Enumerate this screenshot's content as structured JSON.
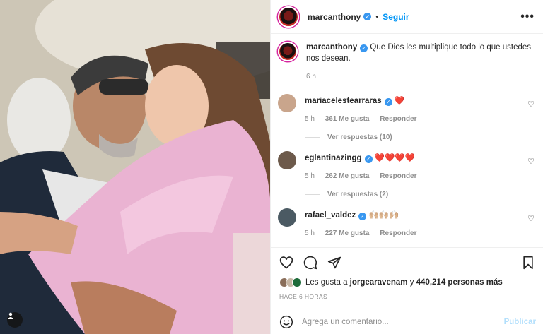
{
  "post": {
    "username": "marcanthony",
    "follow_label": "Seguir",
    "more_label": "•••",
    "caption": "Que Dios les multiplique todo lo que ustedes nos desean.",
    "caption_time": "6 h"
  },
  "comments": [
    {
      "user": "mariacelestearraras",
      "text": "❤️",
      "time": "5 h",
      "likes": "361 Me gusta",
      "reply": "Responder",
      "view_replies": "Ver respuestas (10)",
      "avatar_color": "#c9a58c"
    },
    {
      "user": "eglantinazingg",
      "text": "❤️❤️❤️❤️",
      "time": "5 h",
      "likes": "262 Me gusta",
      "reply": "Responder",
      "view_replies": "Ver respuestas (2)",
      "avatar_color": "#6d5a4b"
    },
    {
      "user": "rafael_valdez",
      "text": "🙌🏼🙌🏼🙌🏼",
      "time": "5 h",
      "likes": "227 Me gusta",
      "reply": "Responder",
      "avatar_color": "#4b5a63"
    }
  ],
  "likes": {
    "prefix": "Les gusta a",
    "user": "jorgearavenam",
    "connector": "y",
    "others": "440,214 personas más"
  },
  "timestamp": "HACE 6 HORAS",
  "add_comment": {
    "placeholder": "Agrega un comentario...",
    "publish_label": "Publicar"
  },
  "colors": {
    "accent": "#0095f6",
    "verified": "#3897f0",
    "heart": "#ed4956"
  }
}
